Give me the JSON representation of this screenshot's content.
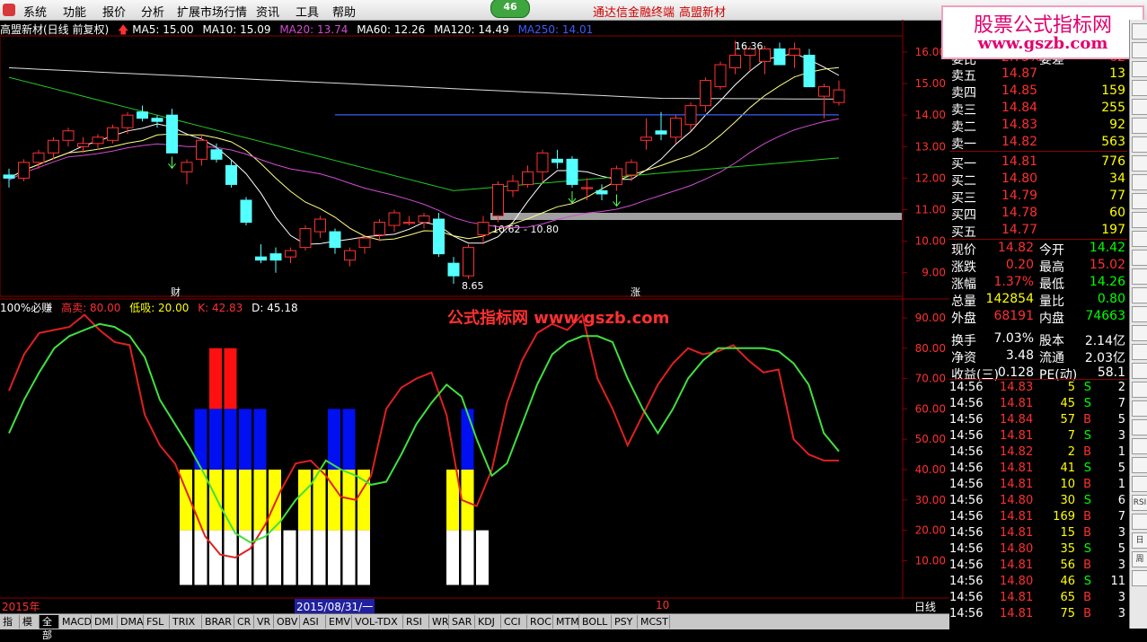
{
  "menu": {
    "items": [
      "系统",
      "功能",
      "报价",
      "分析",
      "扩展市场行情",
      "资讯",
      "工具",
      "帮助"
    ],
    "page_badge": "46",
    "brand_links": [
      "通达信金融终端",
      "高盟新材"
    ]
  },
  "watermark": {
    "line1": "股票公式指标网",
    "line2": "www.gszb.com",
    "center": "公式指标网 www.gszb.com"
  },
  "upper_legend": {
    "title": "高盟新材(日线 前复权)",
    "items": [
      {
        "label": "MA5: 15.00",
        "color": "#ffffff"
      },
      {
        "label": "MA10: 15.09",
        "color": "#ffffff"
      },
      {
        "label": "MA20: 13.74",
        "color": "#d24cd2"
      },
      {
        "label": "MA60: 12.26",
        "color": "#ffffff"
      },
      {
        "label": "MA120: 14.49",
        "color": "#ffffff"
      },
      {
        "label": "MA250: 14.01",
        "color": "#3a5cff"
      }
    ]
  },
  "lower_legend": {
    "title": "100%必赚",
    "items": [
      {
        "label": "高卖: 80.00",
        "color": "#ff3030"
      },
      {
        "label": "低吸: 20.00",
        "color": "#ffff00"
      },
      {
        "label": "K: 42.83",
        "color": "#ff3030"
      },
      {
        "label": "D: 45.18",
        "color": "#ffffff"
      }
    ]
  },
  "chart_data": [
    {
      "type": "candlestick",
      "title": "高盟新材(日线 前复权)",
      "y_ticks": [
        "16.00",
        "15.00",
        "14.00",
        "13.00",
        "12.00",
        "11.00",
        "10.00",
        "9.00"
      ],
      "ylim": [
        8.5,
        16.5
      ],
      "annotations": {
        "high": "16.36",
        "low": "8.65",
        "range_label": "10.62 - 10.80",
        "cai": "财",
        "zhang": "涨"
      },
      "candles": [
        [
          12.1,
          12.3,
          11.7,
          12.0
        ],
        [
          12.0,
          12.6,
          11.9,
          12.5
        ],
        [
          12.5,
          12.9,
          12.3,
          12.8
        ],
        [
          12.8,
          13.3,
          12.6,
          13.2
        ],
        [
          13.2,
          13.6,
          13.0,
          13.5
        ],
        [
          13.0,
          13.3,
          12.8,
          13.1
        ],
        [
          13.1,
          13.4,
          12.9,
          13.3
        ],
        [
          13.2,
          13.7,
          13.1,
          13.6
        ],
        [
          13.6,
          14.1,
          13.4,
          14.0
        ],
        [
          14.1,
          14.3,
          13.8,
          13.9
        ],
        [
          13.9,
          14.0,
          13.6,
          13.8
        ],
        [
          14.0,
          14.2,
          12.8,
          12.8
        ],
        [
          12.2,
          12.6,
          11.8,
          12.5
        ],
        [
          12.6,
          13.4,
          12.4,
          13.2
        ],
        [
          12.9,
          13.1,
          12.5,
          12.6
        ],
        [
          12.4,
          12.6,
          11.7,
          11.8
        ],
        [
          11.3,
          11.4,
          10.5,
          10.6
        ],
        [
          9.5,
          9.9,
          9.3,
          9.4
        ],
        [
          9.6,
          9.8,
          9.0,
          9.4
        ],
        [
          9.5,
          9.8,
          9.3,
          9.7
        ],
        [
          9.8,
          10.5,
          9.7,
          10.4
        ],
        [
          10.3,
          10.8,
          10.1,
          10.7
        ],
        [
          10.3,
          10.4,
          9.6,
          9.8
        ],
        [
          9.4,
          9.8,
          9.2,
          9.7
        ],
        [
          9.8,
          10.2,
          9.6,
          10.1
        ],
        [
          10.2,
          10.7,
          10.0,
          10.6
        ],
        [
          10.5,
          11.0,
          10.3,
          10.9
        ],
        [
          10.6,
          10.8,
          10.5,
          10.6
        ],
        [
          10.6,
          10.9,
          10.4,
          10.8
        ],
        [
          10.7,
          10.9,
          9.5,
          9.6
        ],
        [
          9.3,
          9.5,
          8.65,
          8.9
        ],
        [
          8.9,
          9.9,
          8.8,
          9.8
        ],
        [
          10.2,
          10.8,
          9.9,
          10.6
        ],
        [
          10.8,
          11.9,
          10.6,
          11.8
        ],
        [
          11.6,
          12.1,
          11.4,
          11.9
        ],
        [
          11.8,
          12.4,
          11.7,
          12.2
        ],
        [
          12.2,
          12.9,
          11.9,
          12.8
        ],
        [
          12.6,
          12.9,
          12.3,
          12.5
        ],
        [
          12.6,
          12.7,
          11.7,
          11.8
        ],
        [
          11.7,
          12.0,
          11.3,
          11.7
        ],
        [
          11.6,
          11.8,
          11.3,
          11.5
        ],
        [
          11.8,
          12.4,
          11.6,
          12.3
        ],
        [
          12.1,
          12.6,
          11.9,
          12.5
        ],
        [
          13.2,
          13.9,
          12.9,
          13.3
        ],
        [
          13.5,
          14.1,
          13.2,
          13.4
        ],
        [
          13.3,
          14.0,
          13.1,
          13.9
        ],
        [
          13.7,
          14.4,
          13.5,
          14.3
        ],
        [
          14.3,
          15.2,
          14.1,
          15.1
        ],
        [
          14.9,
          15.7,
          14.8,
          15.6
        ],
        [
          15.5,
          16.36,
          15.3,
          15.9
        ],
        [
          15.9,
          16.2,
          15.4,
          16.1
        ],
        [
          15.7,
          16.2,
          15.3,
          16.1
        ],
        [
          16.1,
          16.3,
          15.6,
          15.6
        ],
        [
          15.9,
          16.3,
          15.5,
          16.1
        ],
        [
          15.9,
          16.1,
          14.9,
          14.9
        ],
        [
          14.6,
          15.0,
          13.9,
          14.9
        ],
        [
          14.4,
          15.1,
          14.3,
          14.8
        ]
      ]
    },
    {
      "type": "line",
      "title": "100%必赚",
      "y_ticks": [
        "90.00",
        "80.00",
        "70.00",
        "60.00",
        "50.00",
        "40.00",
        "30.00",
        "20.00",
        "10.00"
      ],
      "ylim": [
        0,
        95
      ],
      "series": [
        {
          "name": "K",
          "color": "#ff3030",
          "values": [
            66,
            78,
            85,
            86,
            87,
            91,
            86,
            82,
            81,
            58,
            48,
            42,
            30,
            18,
            12,
            11,
            14,
            22,
            33,
            42,
            43,
            38,
            31,
            30,
            38,
            60,
            67,
            70,
            72,
            58,
            30,
            28,
            40,
            62,
            76,
            85,
            88,
            86,
            91,
            70,
            60,
            48,
            58,
            68,
            75,
            80,
            78,
            79,
            81,
            76,
            72,
            73,
            50,
            45,
            43,
            43
          ]
        },
        {
          "name": "D",
          "color": "#ffffff",
          "values": [
            52,
            63,
            72,
            80,
            84,
            86,
            88,
            87,
            84,
            77,
            63,
            55,
            47,
            38,
            28,
            19,
            16,
            18,
            23,
            30,
            35,
            43,
            40,
            38,
            35,
            36,
            45,
            55,
            62,
            68,
            64,
            50,
            38,
            42,
            55,
            68,
            78,
            82,
            84,
            84,
            82,
            70,
            60,
            52,
            60,
            70,
            76,
            80,
            80,
            80,
            80,
            79,
            75,
            68,
            52,
            46
          ]
        }
      ],
      "bars": [
        {
          "i": 12,
          "v": 40
        },
        {
          "i": 13,
          "v": 60
        },
        {
          "i": 14,
          "v": 80
        },
        {
          "i": 15,
          "v": 80
        },
        {
          "i": 16,
          "v": 60
        },
        {
          "i": 17,
          "v": 60
        },
        {
          "i": 18,
          "v": 40
        },
        {
          "i": 19,
          "v": 20
        },
        {
          "i": 20,
          "v": 40
        },
        {
          "i": 21,
          "v": 40
        },
        {
          "i": 22,
          "v": 60
        },
        {
          "i": 23,
          "v": 60
        },
        {
          "i": 24,
          "v": 40
        },
        {
          "i": 30,
          "v": 40
        },
        {
          "i": 31,
          "v": 60
        },
        {
          "i": 32,
          "v": 20
        }
      ],
      "x_labels": {
        "year": "2015年",
        "date": "2015/08/31/一",
        "month": "10",
        "period": "日线"
      }
    }
  ],
  "orderbook": {
    "header": {
      "label": "委比",
      "value": "2.75%",
      "label2": "委差",
      "value2": "62"
    },
    "asks": [
      {
        "label": "卖五",
        "price": "14.87",
        "vol": "13"
      },
      {
        "label": "卖四",
        "price": "14.85",
        "vol": "159"
      },
      {
        "label": "卖三",
        "price": "14.84",
        "vol": "255"
      },
      {
        "label": "卖二",
        "price": "14.83",
        "vol": "92"
      },
      {
        "label": "卖一",
        "price": "14.82",
        "vol": "563"
      }
    ],
    "bids": [
      {
        "label": "买一",
        "price": "14.81",
        "vol": "776"
      },
      {
        "label": "买二",
        "price": "14.80",
        "vol": "34"
      },
      {
        "label": "买三",
        "price": "14.79",
        "vol": "77"
      },
      {
        "label": "买四",
        "price": "14.78",
        "vol": "60"
      },
      {
        "label": "买五",
        "price": "14.77",
        "vol": "197"
      }
    ]
  },
  "quote": [
    {
      "l1": "现价",
      "v1": "14.82",
      "c1": "#ff3030",
      "l2": "今开",
      "v2": "14.42",
      "c2": "#00ff00"
    },
    {
      "l1": "涨跌",
      "v1": "0.20",
      "c1": "#ff3030",
      "l2": "最高",
      "v2": "15.02",
      "c2": "#ff3030"
    },
    {
      "l1": "涨幅",
      "v1": "1.37%",
      "c1": "#ff3030",
      "l2": "最低",
      "v2": "14.26",
      "c2": "#00ff00"
    },
    {
      "l1": "总量",
      "v1": "142854",
      "c1": "#ffff00",
      "l2": "量比",
      "v2": "0.80",
      "c2": "#00ff00"
    },
    {
      "l1": "外盘",
      "v1": "68191",
      "c1": "#ff3030",
      "l2": "内盘",
      "v2": "74663",
      "c2": "#00ff00"
    },
    {
      "l1": "换手",
      "v1": "7.03%",
      "c1": "#ffffff",
      "l2": "股本",
      "v2": "2.14亿",
      "c2": "#ffffff"
    },
    {
      "l1": "净资",
      "v1": "3.48",
      "c1": "#ffffff",
      "l2": "流通",
      "v2": "2.03亿",
      "c2": "#ffffff"
    },
    {
      "l1": "收益(三)",
      "v1": "0.128",
      "c1": "#ffffff",
      "l2": "PE(动)",
      "v2": "58.1",
      "c2": "#ffffff"
    }
  ],
  "trades": [
    {
      "t": "14:56",
      "p": "14.83",
      "v": "5",
      "s": "S",
      "n": "2"
    },
    {
      "t": "14:56",
      "p": "14.81",
      "v": "45",
      "s": "S",
      "n": "7"
    },
    {
      "t": "14:56",
      "p": "14.84",
      "v": "57",
      "s": "B",
      "n": "5"
    },
    {
      "t": "14:56",
      "p": "14.81",
      "v": "7",
      "s": "S",
      "n": "3"
    },
    {
      "t": "14:56",
      "p": "14.82",
      "v": "2",
      "s": "B",
      "n": "1"
    },
    {
      "t": "14:56",
      "p": "14.81",
      "v": "41",
      "s": "S",
      "n": "5"
    },
    {
      "t": "14:56",
      "p": "14.81",
      "v": "10",
      "s": "B",
      "n": "1"
    },
    {
      "t": "14:56",
      "p": "14.80",
      "v": "30",
      "s": "S",
      "n": "6"
    },
    {
      "t": "14:56",
      "p": "14.81",
      "v": "169",
      "s": "B",
      "n": "7"
    },
    {
      "t": "14:56",
      "p": "14.81",
      "v": "15",
      "s": "B",
      "n": "3"
    },
    {
      "t": "14:56",
      "p": "14.80",
      "v": "35",
      "s": "S",
      "n": "5"
    },
    {
      "t": "14:56",
      "p": "14.81",
      "v": "56",
      "s": "B",
      "n": "3"
    },
    {
      "t": "14:56",
      "p": "14.80",
      "v": "46",
      "s": "S",
      "n": "11"
    },
    {
      "t": "14:56",
      "p": "14.81",
      "v": "65",
      "s": "B",
      "n": "3"
    },
    {
      "t": "14:56",
      "p": "14.81",
      "v": "75",
      "s": "B",
      "n": "3"
    }
  ],
  "bottom_tabs": [
    "指标",
    "模板",
    "全部",
    "MACD",
    "DMI",
    "DMA",
    "FSL",
    "TRIX",
    "BRAR",
    "CR",
    "VR",
    "OBV",
    "ASI",
    "EMV",
    "VOL-TDX",
    "RSI",
    "WR",
    "SAR",
    "KDJ",
    "CCI",
    "ROC",
    "MTM",
    "BOLL",
    "PSY",
    "MCST"
  ],
  "right_tools": [
    "日",
    "周",
    "Fiz",
    "RSI",
    "F10"
  ]
}
